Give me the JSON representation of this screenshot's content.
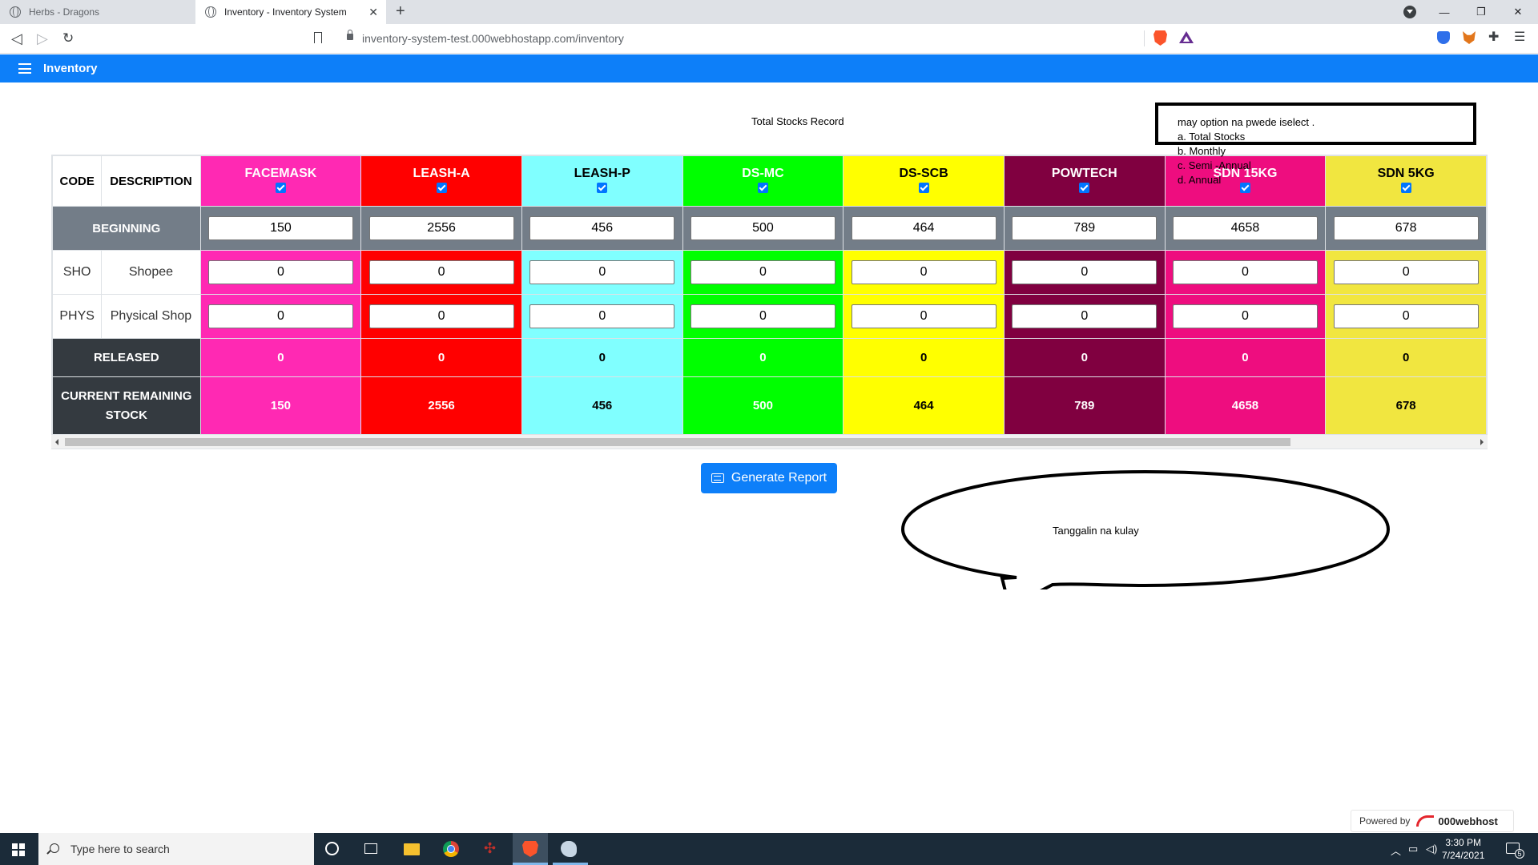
{
  "browser": {
    "tabs": [
      {
        "title": "Herbs - Dragons",
        "active": false
      },
      {
        "title": "Inventory - Inventory System",
        "active": true
      }
    ],
    "url": "inventory-system-test.000webhostapp.com/inventory"
  },
  "navbar": {
    "brand": "Inventory",
    "color": "#0d7ff9"
  },
  "page": {
    "record_title": "Total Stocks Record",
    "generate_button": "Generate Report"
  },
  "annotation_note": {
    "lines": [
      "may option na pwede iselect .",
      "a. Total Stocks",
      "b. Monthly",
      "c. Semi -Annual",
      "d. Annual"
    ]
  },
  "speech_bubble": {
    "text": "Tanggalin na kulay"
  },
  "table": {
    "headers": {
      "code": "CODE",
      "description": "DESCRIPTION"
    },
    "rows": {
      "beginning": "BEGINNING",
      "released": "RELEASED",
      "current_line1": "CURRENT REMAINING",
      "current_line2": "STOCK"
    },
    "sources": [
      {
        "code": "SHO",
        "description": "Shopee"
      },
      {
        "code": "PHYS",
        "description": "Physical Shop"
      }
    ],
    "products": [
      {
        "name": "FACEMASK",
        "color": "#ff29b3",
        "checked": true,
        "beginning": "150",
        "shopee": "0",
        "physical": "0",
        "released": "0",
        "current": "150",
        "dark_text": false
      },
      {
        "name": "LEASH-A",
        "color": "#ff0000",
        "checked": true,
        "beginning": "2556",
        "shopee": "0",
        "physical": "0",
        "released": "0",
        "current": "2556",
        "dark_text": false
      },
      {
        "name": "LEASH-P",
        "color": "#80ffff",
        "checked": true,
        "beginning": "456",
        "shopee": "0",
        "physical": "0",
        "released": "0",
        "current": "456",
        "dark_text": true
      },
      {
        "name": "DS-MC",
        "color": "#00ff00",
        "checked": true,
        "beginning": "500",
        "shopee": "0",
        "physical": "0",
        "released": "0",
        "current": "500",
        "dark_text": false
      },
      {
        "name": "DS-SCB",
        "color": "#ffff00",
        "checked": true,
        "beginning": "464",
        "shopee": "0",
        "physical": "0",
        "released": "0",
        "current": "464",
        "dark_text": true
      },
      {
        "name": "POWTECH",
        "color": "#800040",
        "checked": true,
        "beginning": "789",
        "shopee": "0",
        "physical": "0",
        "released": "0",
        "current": "789",
        "dark_text": false
      },
      {
        "name": "SDN 15KG",
        "color": "#ee0d7f",
        "checked": true,
        "beginning": "4658",
        "shopee": "0",
        "physical": "0",
        "released": "0",
        "current": "4658",
        "dark_text": false
      },
      {
        "name": "SDN 5KG",
        "color": "#f1e640",
        "checked": true,
        "beginning": "678",
        "shopee": "0",
        "physical": "0",
        "released": "0",
        "current": "678",
        "dark_text": true
      }
    ]
  },
  "footer": {
    "powered_by": "Powered by",
    "host_brand": "000webhost"
  },
  "taskbar": {
    "search_placeholder": "Type here to search",
    "time": "3:30 PM",
    "date": "7/24/2021",
    "notification_count": "5"
  }
}
